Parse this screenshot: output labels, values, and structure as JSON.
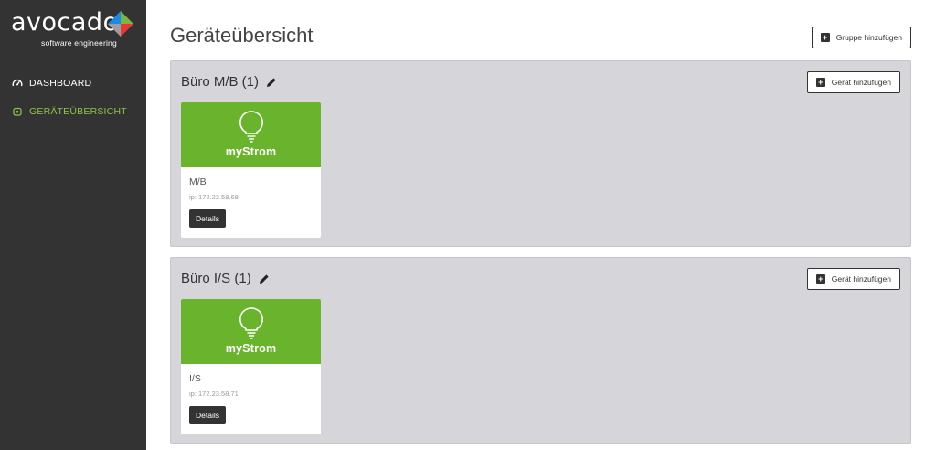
{
  "brand": {
    "word": "avocado",
    "sub": "software engineering",
    "colors": {
      "red": "#e53935",
      "green": "#7cb342",
      "blue": "#1e88e5",
      "gray": "#9e9e9e"
    }
  },
  "sidebar": {
    "items": [
      {
        "label": "DASHBOARD",
        "icon": "dashboard-gauge-icon",
        "active": false
      },
      {
        "label": "GERÄTEÜBERSICHT",
        "icon": "device-icon",
        "active": true
      }
    ]
  },
  "page": {
    "title": "Geräteübersicht",
    "add_group_label": "Gruppe hinzufügen"
  },
  "groups": [
    {
      "title": "Büro M/B (1)",
      "add_device_label": "Gerät hinzufügen",
      "devices": [
        {
          "brand": "myStrom",
          "name": "M/B",
          "ip": "ip: 172.23.58.68",
          "details_label": "Details"
        }
      ]
    },
    {
      "title": "Büro I/S (1)",
      "add_device_label": "Gerät hinzufügen",
      "devices": [
        {
          "brand": "myStrom",
          "name": "I/S",
          "ip": "ip: 172.23.58.71",
          "details_label": "Details"
        }
      ]
    }
  ],
  "colors": {
    "sidebar_bg": "#333333",
    "accent_green": "#8bc34a",
    "card_banner": "#6ab42d",
    "group_bg": "#d6d5da"
  }
}
